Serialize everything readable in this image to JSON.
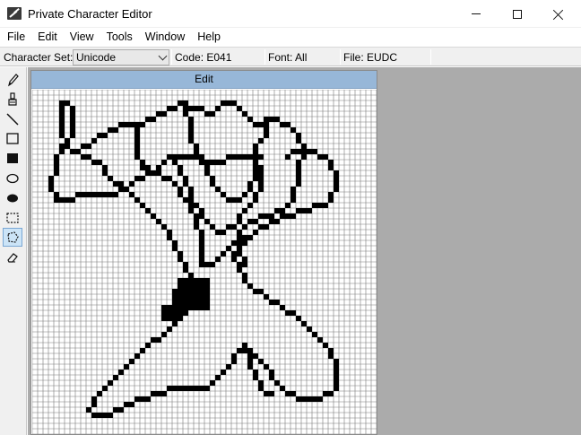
{
  "window": {
    "title": "Private Character Editor",
    "icon": "character-editor-icon"
  },
  "menu": [
    "File",
    "Edit",
    "View",
    "Tools",
    "Window",
    "Help"
  ],
  "info": {
    "character_set_label": "Character Set:",
    "character_set_value": "Unicode",
    "code": "Code: E041",
    "font": "Font: All",
    "file": "File: EUDC"
  },
  "tools": [
    {
      "name": "pencil-icon",
      "active": false
    },
    {
      "name": "brush-icon",
      "active": false
    },
    {
      "name": "line-icon",
      "active": false
    },
    {
      "name": "hollow-rectangle-icon",
      "active": false
    },
    {
      "name": "filled-rectangle-icon",
      "active": false
    },
    {
      "name": "hollow-ellipse-icon",
      "active": false
    },
    {
      "name": "filled-ellipse-icon",
      "active": false
    },
    {
      "name": "rectangular-selection-icon",
      "active": false
    },
    {
      "name": "freeform-selection-icon",
      "active": true
    },
    {
      "name": "eraser-icon",
      "active": false
    }
  ],
  "editor": {
    "title": "Edit",
    "grid_cells": 64
  }
}
